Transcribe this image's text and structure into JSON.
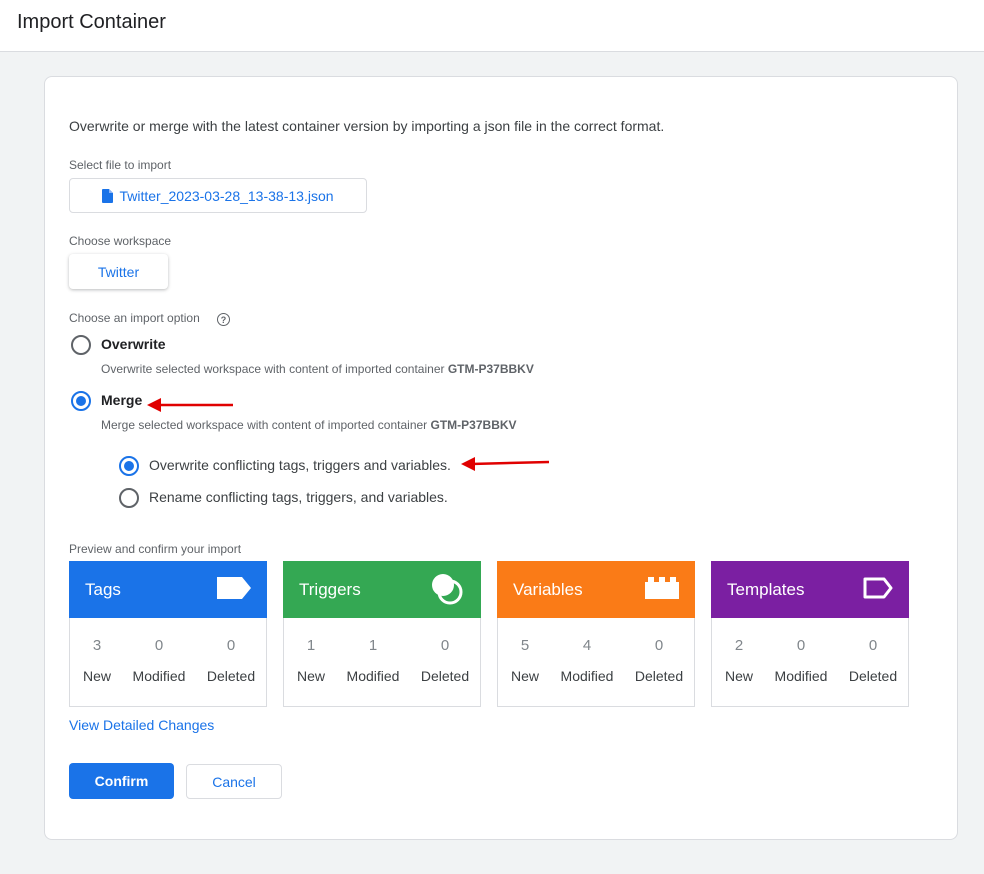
{
  "header": {
    "title": "Import Container"
  },
  "intro": "Overwrite or merge with the latest container version by importing a json file in the correct format.",
  "file": {
    "label": "Select file to import",
    "name": "Twitter_2023-03-28_13-38-13.json",
    "icon": "file-icon"
  },
  "workspace": {
    "label": "Choose workspace",
    "value": "Twitter"
  },
  "import_option": {
    "label": "Choose an import option",
    "help_icon": "help-icon",
    "help_glyph": "?",
    "overwrite": {
      "title": "Overwrite",
      "desc": "Overwrite selected workspace with content of imported container",
      "container_id": "GTM-P37BBKV",
      "selected": false
    },
    "merge": {
      "title": "Merge",
      "desc": "Merge selected workspace with content of imported container",
      "container_id": "GTM-P37BBKV",
      "selected": true,
      "sub_options": [
        {
          "label": "Overwrite conflicting tags, triggers and variables.",
          "selected": true
        },
        {
          "label": "Rename conflicting tags, triggers, and variables.",
          "selected": false
        }
      ]
    }
  },
  "preview": {
    "label": "Preview and confirm your import",
    "stat_labels": [
      "New",
      "Modified",
      "Deleted"
    ],
    "tiles": [
      {
        "title": "Tags",
        "color": "#1a73e8",
        "icon": "tag-icon",
        "values": [
          "3",
          "0",
          "0"
        ]
      },
      {
        "title": "Triggers",
        "color": "#34a853",
        "icon": "trigger-icon",
        "values": [
          "1",
          "1",
          "0"
        ]
      },
      {
        "title": "Variables",
        "color": "#fa7b17",
        "icon": "variable-blocks-icon",
        "values": [
          "5",
          "4",
          "0"
        ]
      },
      {
        "title": "Templates",
        "color": "#7b1fa2",
        "icon": "template-tag-icon",
        "values": [
          "2",
          "0",
          "0"
        ]
      }
    ]
  },
  "view_changes_link": "View Detailed Changes",
  "buttons": {
    "confirm": "Confirm",
    "cancel": "Cancel"
  },
  "annotations": {
    "arrow_color": "#e00000"
  }
}
